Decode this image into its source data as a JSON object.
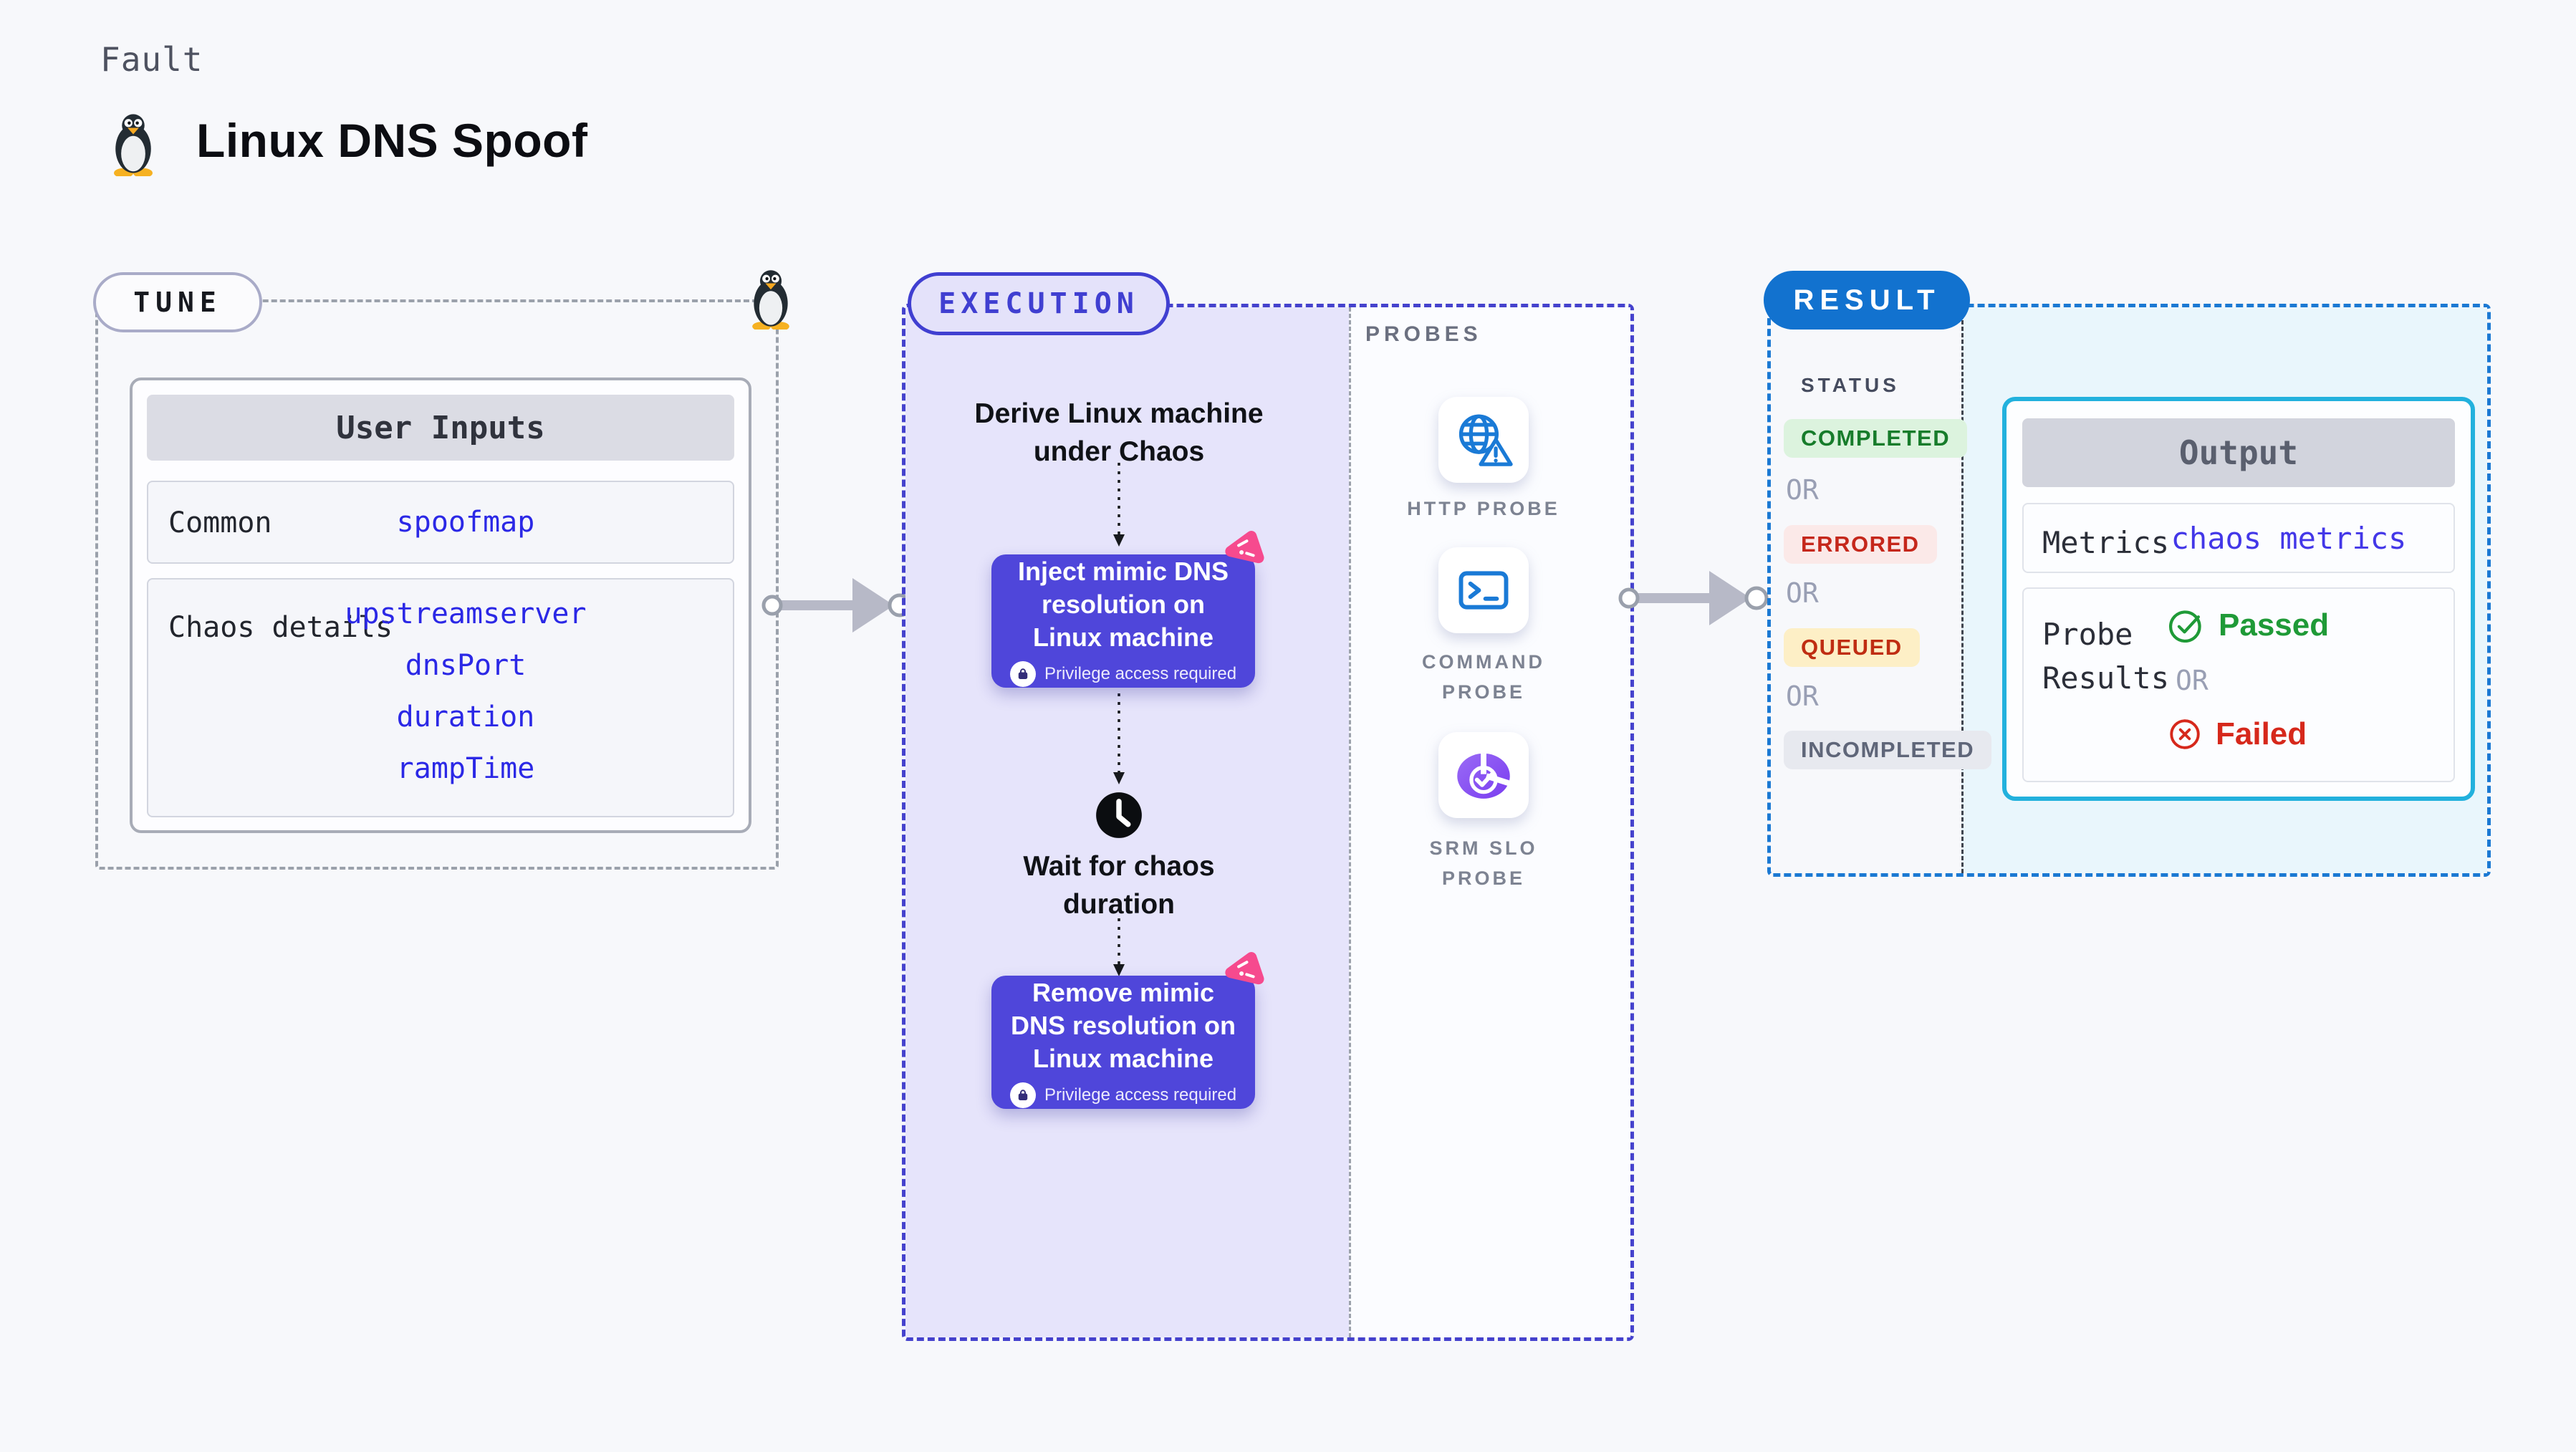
{
  "header": {
    "kicker": "Fault",
    "title": "Linux DNS Spoof"
  },
  "tune": {
    "pill": "TUNE",
    "table_header": "User Inputs",
    "rows": [
      {
        "label": "Common",
        "values": [
          "spoofmap"
        ]
      },
      {
        "label": "Chaos details",
        "values": [
          "upstreamserver",
          "dnsPort",
          "duration",
          "rampTime"
        ]
      }
    ]
  },
  "execution": {
    "pill": "EXECUTION",
    "derive": "Derive Linux machine under Chaos",
    "inject": "Inject mimic DNS resolution on Linux machine",
    "wait": "Wait for chaos duration",
    "remove": "Remove mimic DNS resolution on Linux machine",
    "privilege_note": "Privilege access required"
  },
  "probes": {
    "label": "PROBES",
    "items": [
      {
        "label": "HTTP PROBE",
        "icon": "globe-alert-icon"
      },
      {
        "label": "COMMAND PROBE",
        "icon": "terminal-icon"
      },
      {
        "label": "SRM SLO PROBE",
        "icon": "pie-check-icon"
      }
    ]
  },
  "result": {
    "pill": "RESULT",
    "status_label": "STATUS",
    "or_label": "OR",
    "statuses": [
      {
        "label": "COMPLETED",
        "text_color": "#177C2B",
        "bg": "#DCF3DE"
      },
      {
        "label": "ERRORED",
        "text_color": "#C5271B",
        "bg": "#FBE9E8"
      },
      {
        "label": "QUEUED",
        "text_color": "#BF2D12",
        "bg": "#FDEFC6"
      },
      {
        "label": "INCOMPLETED",
        "text_color": "#5F6679",
        "bg": "#E7E9EF"
      }
    ],
    "output": {
      "header": "Output",
      "metrics_label": "Metrics",
      "metrics_value": "chaos metrics",
      "probe_results_label": "Probe Results",
      "passed_label": "Passed",
      "or_label": "OR",
      "failed_label": "Failed"
    }
  },
  "icons": {
    "title_logo": "tux-penguin-icon",
    "tune_corner": "tux-penguin-icon",
    "chaos_badge": "litmus-chaos-icon",
    "privilege": "padlock-icon",
    "wait_step": "clock-icon",
    "http_probe": "globe-alert-icon",
    "command_probe": "terminal-icon",
    "srm_slo_probe": "pie-check-icon",
    "passed": "check-circle-icon",
    "failed": "x-circle-icon",
    "stage_connector": "flow-arrow-icon"
  },
  "colors": {
    "page_bg": "#F7F8FB",
    "tune_border": "#9BA1AB",
    "execution_accent": "#4542CD",
    "execution_fill": "#E6E4FB",
    "chaos_card": "#4F46DA",
    "litmus_pink": "#F64A8E",
    "result_accent": "#1B79D3",
    "result_pill": "#1272CF",
    "output_border": "#22B1DD",
    "output_fill": "#E9F6FC",
    "probe_icon_blue": "#1A7AD6",
    "srm_purple": "#7A3DF0",
    "value_blue": "#2B28E6",
    "passed_green": "#1F9A37",
    "failed_red": "#D6281B"
  }
}
